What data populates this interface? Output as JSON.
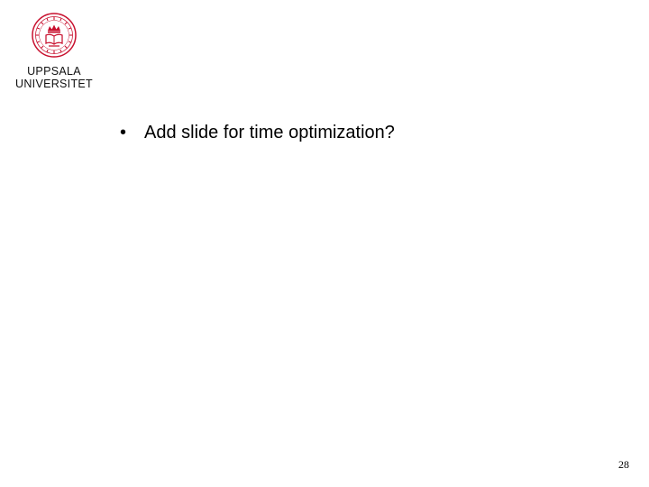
{
  "logo": {
    "icon": "uppsala-university-seal-icon",
    "color": "#c8102e",
    "line1": "UPPSALA",
    "line2": "UNIVERSITET"
  },
  "bullets": [
    {
      "marker": "•",
      "text": "Add slide for time optimization?"
    }
  ],
  "page_number": "28"
}
